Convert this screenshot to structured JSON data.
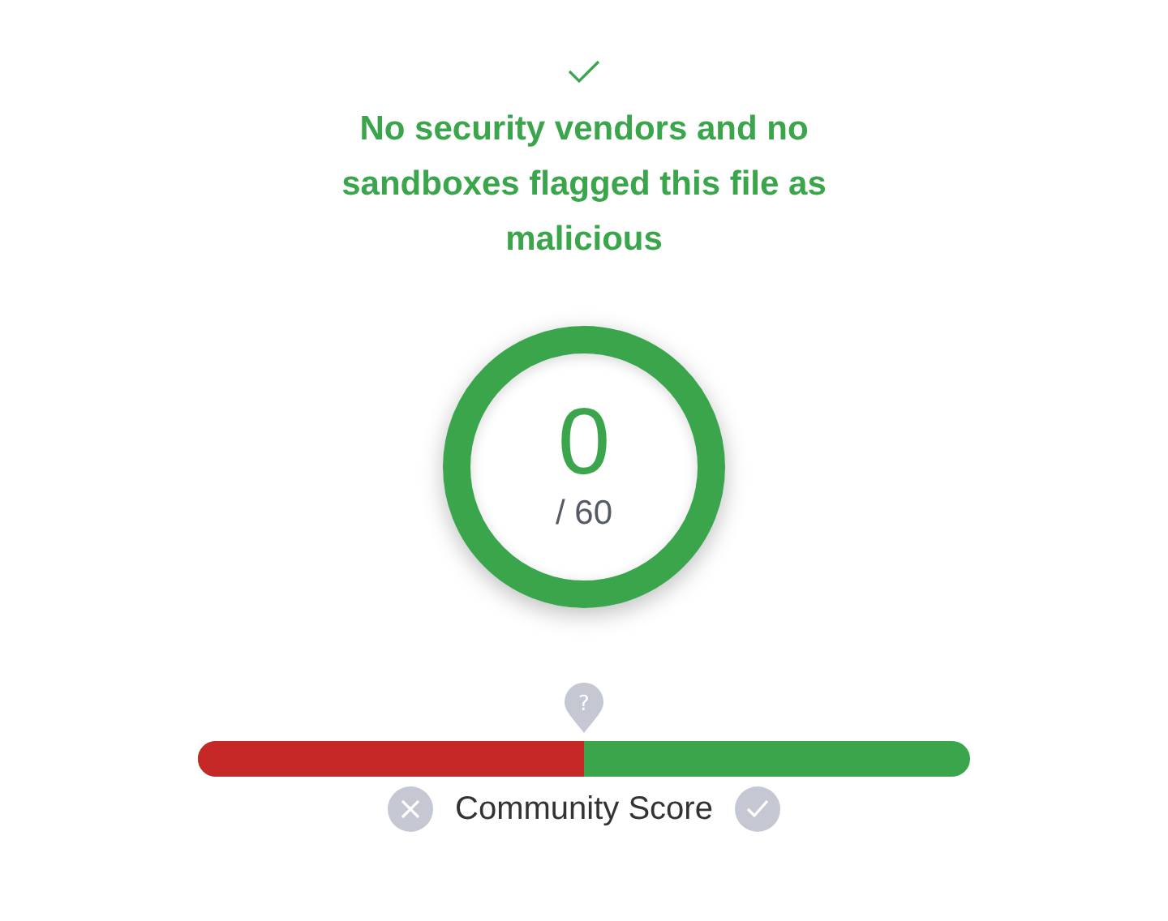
{
  "verdict": {
    "clean": true,
    "message": "No security vendors and no sandboxes flagged this file as malicious"
  },
  "detection": {
    "count": "0",
    "total": "/ 60"
  },
  "community_score": {
    "marker": "?",
    "level": 0.5,
    "label": "Community Score"
  }
}
